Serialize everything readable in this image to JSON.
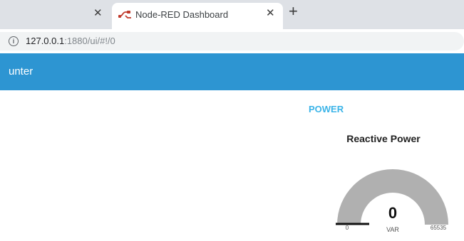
{
  "browser": {
    "tabs": [
      {
        "label": "",
        "active": false
      },
      {
        "label": "Node-RED Dashboard",
        "active": true
      }
    ],
    "new_tab_icon": "plus-icon",
    "address": {
      "host": "127.0.0.1",
      "path": ":1880/ui/#!/0"
    }
  },
  "dashboard": {
    "title": "unter",
    "group": {
      "title": "POWER",
      "gauge": {
        "title": "Reactive Power",
        "value": "0",
        "units": "VAR",
        "min": "0",
        "max": "65535",
        "fraction": 0.0
      }
    }
  },
  "colors": {
    "toolbar": "#2d95d2",
    "group_title": "#3bb4e8",
    "gauge_track": "#b0b0b0",
    "tab_strip": "#dee1e6"
  }
}
